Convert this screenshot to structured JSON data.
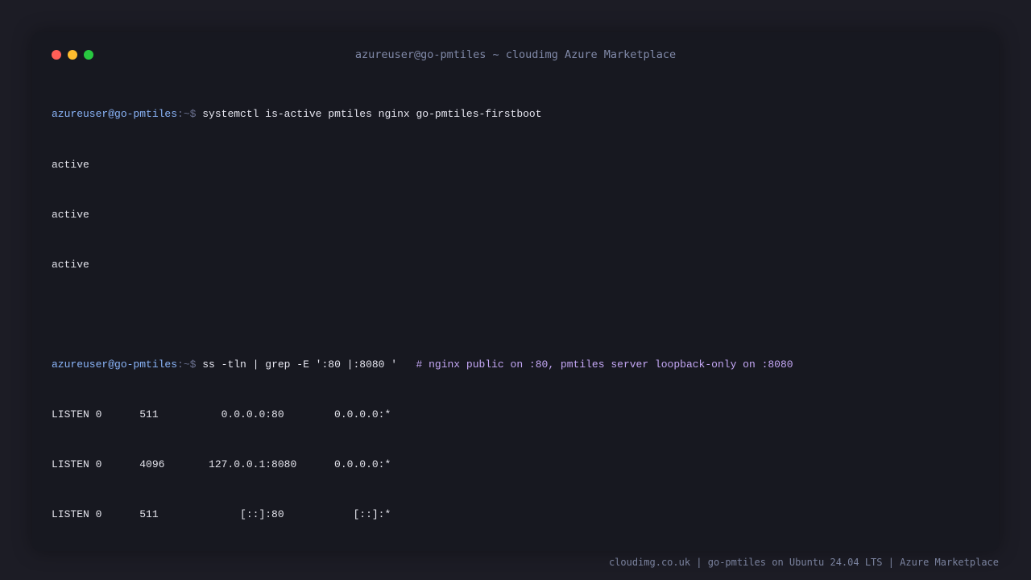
{
  "window": {
    "title": "azureuser@go-pmtiles ~ cloudimg Azure Marketplace"
  },
  "terminal": {
    "block1": {
      "prompt_user": "azureuser@go-pmtiles",
      "prompt_path": ":~$ ",
      "command": "systemctl is-active pmtiles nginx go-pmtiles-firstboot",
      "output": [
        "active",
        "active",
        "active"
      ]
    },
    "block2": {
      "prompt_user": "azureuser@go-pmtiles",
      "prompt_path": ":~$ ",
      "command": "ss -tln | grep -E ':80 |:8080 '   ",
      "comment": "# nginx public on :80, pmtiles server loopback-only on :8080",
      "output": [
        "LISTEN 0      511          0.0.0.0:80        0.0.0.0:*",
        "LISTEN 0      4096       127.0.0.1:8080      0.0.0.0:*",
        "LISTEN 0      511             [::]:80           [::]:*"
      ]
    }
  },
  "footer": {
    "text": "cloudimg.co.uk | go-pmtiles on Ubuntu 24.04 LTS | Azure Marketplace"
  },
  "colors": {
    "background": "#1c1c25",
    "window": "#171820",
    "prompt": "#8ab4f8",
    "comment": "#c4a7f5",
    "close": "#ff5f57",
    "minimize": "#febc2e",
    "maximize": "#28c840"
  }
}
